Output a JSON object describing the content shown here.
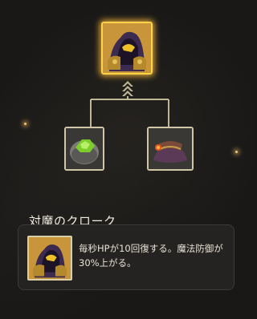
{
  "item_tree": {
    "root": {
      "name": "cloak-item",
      "selected": true
    },
    "children": [
      {
        "name": "stone-item"
      },
      {
        "name": "neck-cloak-item"
      }
    ]
  },
  "detail": {
    "title": "対魔のクローク",
    "description": "毎秒HPが10回復する。魔法防御が30%上がる。"
  },
  "colors": {
    "background": "#191817",
    "gold_border": "#ffd24a",
    "line": "#bfb795"
  }
}
